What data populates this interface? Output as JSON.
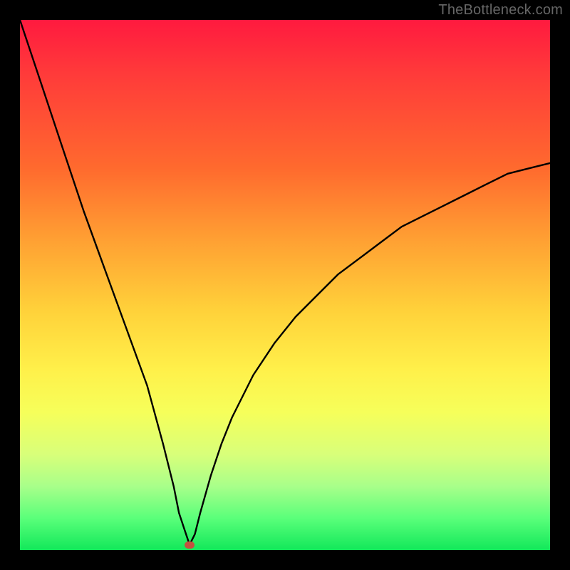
{
  "brand": "TheBottleneck.com",
  "colors": {
    "page_bg": "#000000",
    "curve": "#000000",
    "dot": "#c4523f",
    "gradient_top": "#ff1a3f",
    "gradient_bottom": "#12e85a"
  },
  "chart_data": {
    "type": "line",
    "title": "",
    "xlabel": "",
    "ylabel": "",
    "xlim": [
      0,
      100
    ],
    "ylim": [
      0,
      100
    ],
    "notes": "No axes or tick labels are shown in the image; x and y are normalized 0–100. The curve plunges steeply from top-left to a minimum near x≈32 and then rises with a decelerating (square-root-like) shape toward the right edge reaching roughly y≈73.",
    "series": [
      {
        "name": "bottleneck-curve",
        "x": [
          0,
          4,
          8,
          12,
          16,
          20,
          24,
          27,
          29,
          30,
          31,
          32,
          33,
          34,
          36,
          38,
          40,
          44,
          48,
          52,
          56,
          60,
          64,
          68,
          72,
          76,
          80,
          84,
          88,
          92,
          96,
          100
        ],
        "y": [
          100,
          88,
          76,
          64,
          53,
          42,
          31,
          20,
          12,
          7,
          4,
          1.0,
          3,
          7,
          14,
          20,
          25,
          33,
          39,
          44,
          48,
          52,
          55,
          58,
          61,
          63,
          65,
          67,
          69,
          71,
          72,
          73
        ]
      }
    ],
    "marker": {
      "x": 32,
      "y": 1.0
    }
  }
}
